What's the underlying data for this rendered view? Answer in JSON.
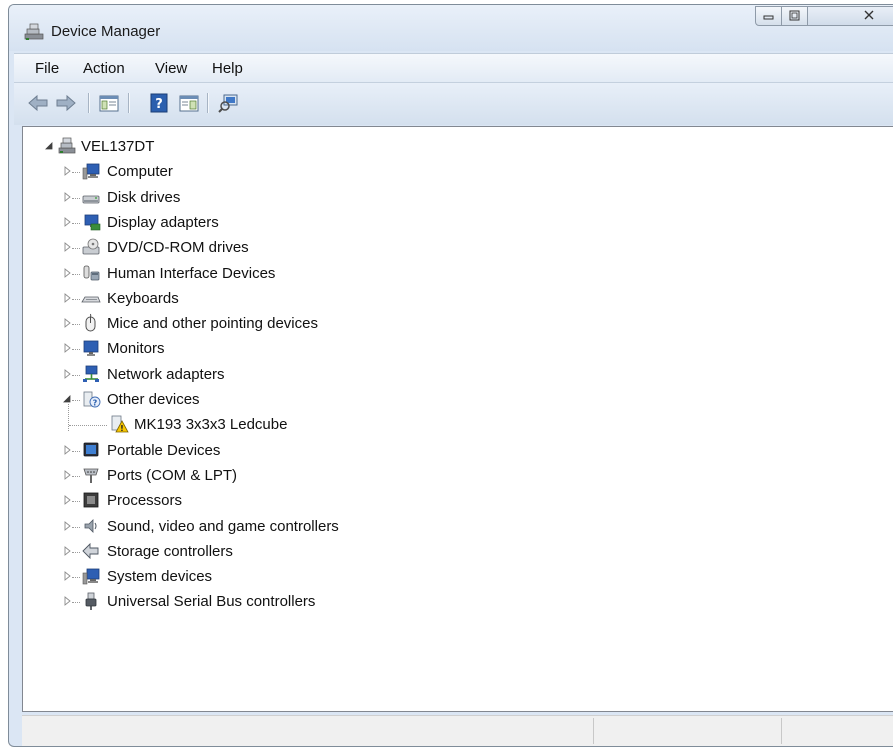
{
  "window": {
    "title": "Device Manager"
  },
  "menu": {
    "items": [
      "File",
      "Action",
      "View",
      "Help"
    ]
  },
  "toolbar": {
    "buttons": [
      "back-icon",
      "forward-icon",
      "console-tree-icon",
      "help-icon",
      "action-pane-icon",
      "scan-hardware-icon"
    ]
  },
  "tree": {
    "root": {
      "label": "VEL137DT",
      "expanded": true,
      "icon": "computer-root-icon"
    },
    "categories": [
      {
        "label": "Computer",
        "icon": "computer-icon",
        "expanded": false
      },
      {
        "label": "Disk drives",
        "icon": "disk-drive-icon",
        "expanded": false
      },
      {
        "label": "Display adapters",
        "icon": "display-adapter-icon",
        "expanded": false
      },
      {
        "label": "DVD/CD-ROM drives",
        "icon": "dvd-drive-icon",
        "expanded": false
      },
      {
        "label": "Human Interface Devices",
        "icon": "hid-icon",
        "expanded": false
      },
      {
        "label": "Keyboards",
        "icon": "keyboard-icon",
        "expanded": false
      },
      {
        "label": "Mice and other pointing devices",
        "icon": "mouse-icon",
        "expanded": false
      },
      {
        "label": "Monitors",
        "icon": "monitor-icon",
        "expanded": false
      },
      {
        "label": "Network adapters",
        "icon": "network-adapter-icon",
        "expanded": false
      },
      {
        "label": "Other devices",
        "icon": "unknown-device-icon",
        "expanded": true,
        "children": [
          {
            "label": "MK193 3x3x3 Ledcube",
            "icon": "warning-device-icon"
          }
        ]
      },
      {
        "label": "Portable Devices",
        "icon": "portable-device-icon",
        "expanded": false
      },
      {
        "label": "Ports (COM & LPT)",
        "icon": "port-icon",
        "expanded": false
      },
      {
        "label": "Processors",
        "icon": "processor-icon",
        "expanded": false
      },
      {
        "label": "Sound, video and game controllers",
        "icon": "sound-icon",
        "expanded": false
      },
      {
        "label": "Storage controllers",
        "icon": "storage-controller-icon",
        "expanded": false
      },
      {
        "label": "System devices",
        "icon": "system-device-icon",
        "expanded": false
      },
      {
        "label": "Universal Serial Bus controllers",
        "icon": "usb-icon",
        "expanded": false
      }
    ]
  },
  "colors": {
    "chrome": "#dbe6f4",
    "content_bg": "#ffffff",
    "text": "#111111"
  }
}
